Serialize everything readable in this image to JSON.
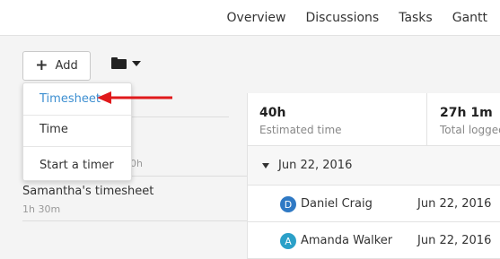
{
  "colors": {
    "accent": "#3d8fd1",
    "arrow": "#e0191b",
    "avatar_blue": "#2f79c4",
    "avatar_teal": "#2ba0c8"
  },
  "nav": {
    "items": [
      "Overview",
      "Discussions",
      "Tasks",
      "Gantt"
    ]
  },
  "toolbar": {
    "add_label": "Add",
    "folder_icon": "folder-icon"
  },
  "dropdown": {
    "items": [
      "Timesheet",
      "Time",
      "Start a timer"
    ],
    "active": "Timesheet"
  },
  "left_list": {
    "partial_duration": "0h",
    "timesheet_name": "Samantha's timesheet",
    "timesheet_duration": "1h 30m"
  },
  "stats": [
    {
      "value": "40h",
      "label": "Estimated time"
    },
    {
      "value": "27h 1m",
      "label": "Total logged"
    }
  ],
  "group": {
    "label": "Jun 22, 2016"
  },
  "entries": [
    {
      "initial": "D",
      "name": "Daniel Craig",
      "date": "Jun 22, 2016"
    },
    {
      "initial": "A",
      "name": "Amanda Walker",
      "date": "Jun 22, 2016"
    }
  ]
}
